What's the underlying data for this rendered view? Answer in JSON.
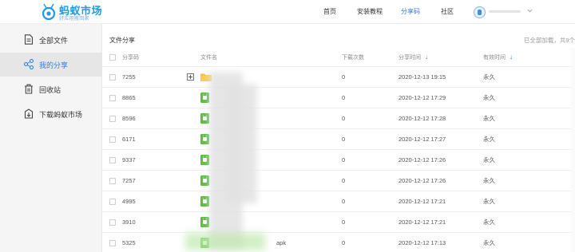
{
  "app": {
    "logo_title": "蚂蚁市场",
    "logo_subtitle": "好应用搬回家",
    "accent_color": "#2f7ee3",
    "logo_color": "#1e9be4"
  },
  "nav": {
    "home": "首页",
    "install_tutorial": "安装教程",
    "share_code": "分享码",
    "community": "社区",
    "active": "分享码"
  },
  "sidebar": {
    "items": [
      {
        "label": "全部文件",
        "icon": "document-icon",
        "active": false
      },
      {
        "label": "我的分享",
        "icon": "share-icon",
        "active": true
      },
      {
        "label": "回收站",
        "icon": "trash-icon",
        "active": false
      },
      {
        "label": "下载蚂蚁市场",
        "icon": "download-icon",
        "active": false
      }
    ]
  },
  "main": {
    "title": "文件分享",
    "loaded_status": "已全部加载，共9个"
  },
  "table": {
    "columns": {
      "code": "分享码",
      "name": "文件名",
      "count": "下载次数",
      "time": "分享时间",
      "valid": "有效时间"
    },
    "rows": [
      {
        "code": "7255",
        "name": "",
        "type": "folder",
        "count": "0",
        "time": "2020-12-13 19:15",
        "valid": "永久"
      },
      {
        "code": "8865",
        "name": "",
        "type": "apk",
        "count": "0",
        "time": "2020-12-12 17:29",
        "valid": "永久"
      },
      {
        "code": "8596",
        "name": "",
        "type": "apk",
        "count": "0",
        "time": "2020-12-12 17:28",
        "valid": "永久"
      },
      {
        "code": "6171",
        "name": "",
        "type": "apk",
        "count": "0",
        "time": "2020-12-12 17:27",
        "valid": "永久"
      },
      {
        "code": "9337",
        "name": "",
        "type": "apk",
        "count": "0",
        "time": "2020-12-12 17:26",
        "valid": "永久"
      },
      {
        "code": "7257",
        "name": "",
        "type": "apk",
        "count": "0",
        "time": "2020-12-12 17:26",
        "valid": "永久"
      },
      {
        "code": "4995",
        "name": "",
        "type": "apk",
        "count": "0",
        "time": "2020-12-12 17:21",
        "valid": "永久"
      },
      {
        "code": "3910",
        "name": "",
        "type": "apk",
        "count": "0",
        "time": "2020-12-12 17:21",
        "valid": "永久"
      },
      {
        "code": "5325",
        "name": "apk",
        "type": "apk",
        "count": "0",
        "time": "2020-12-12 17:13",
        "valid": "永久"
      }
    ]
  }
}
